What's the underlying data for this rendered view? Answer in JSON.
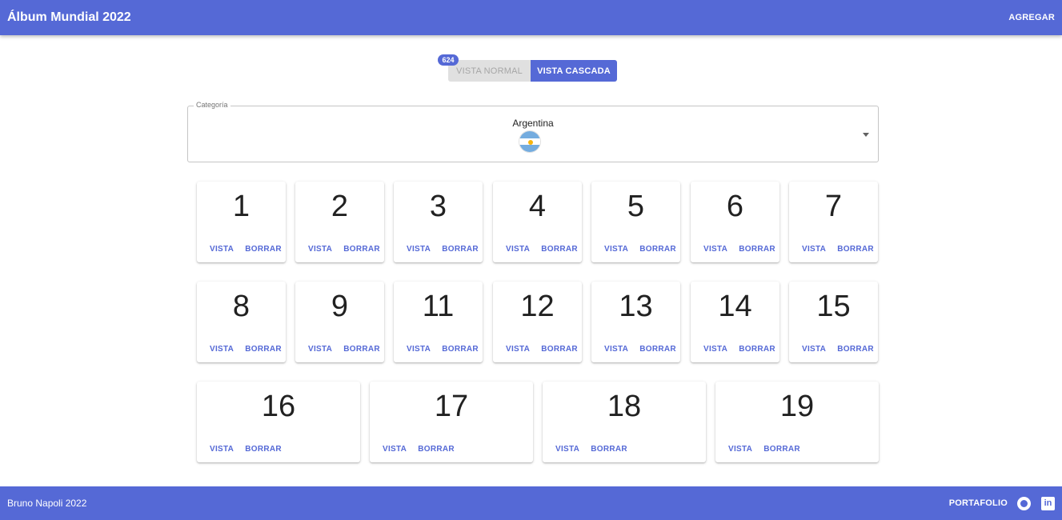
{
  "header": {
    "title": "Álbum Mundial 2022",
    "add_label": "AGREGAR"
  },
  "view_toggle": {
    "badge_count": "624",
    "normal_label": "VISTA NORMAL",
    "cascade_label": "VISTA CASCADA",
    "selected": "VISTA CASCADA"
  },
  "category_select": {
    "label": "Categoría",
    "value": "Argentina",
    "flag_icon": "argentina-flag-icon"
  },
  "card_actions": {
    "view_label": "VISTA",
    "delete_label": "BORRAR"
  },
  "stickers": [
    "1",
    "2",
    "3",
    "4",
    "5",
    "6",
    "7",
    "8",
    "9",
    "11",
    "12",
    "13",
    "14",
    "15",
    "16",
    "17",
    "18",
    "19"
  ],
  "footer": {
    "credit": "Bruno Napoli 2022",
    "portfolio_label": "PORTAFOLIO",
    "icons": [
      "github-icon",
      "linkedin-icon"
    ]
  },
  "colors": {
    "primary": "#5569d6"
  }
}
